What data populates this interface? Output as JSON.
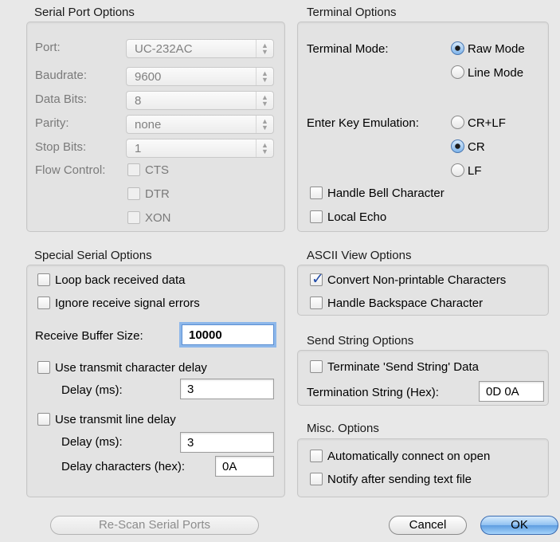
{
  "serial_port_options": {
    "title": "Serial Port Options",
    "port": {
      "label": "Port:",
      "value": "UC-232AC"
    },
    "baudrate": {
      "label": "Baudrate:",
      "value": "9600"
    },
    "data_bits": {
      "label": "Data Bits:",
      "value": "8"
    },
    "parity": {
      "label": "Parity:",
      "value": "none"
    },
    "stop_bits": {
      "label": "Stop Bits:",
      "value": "1"
    },
    "flow_control": {
      "label": "Flow Control:",
      "cts": "CTS",
      "dtr": "DTR",
      "xon": "XON"
    }
  },
  "terminal_options": {
    "title": "Terminal Options",
    "mode_label": "Terminal Mode:",
    "raw_mode": "Raw Mode",
    "line_mode": "Line Mode",
    "selected_mode": "Raw Mode",
    "enter_key_label": "Enter Key Emulation:",
    "crlf": "CR+LF",
    "cr": "CR",
    "lf": "LF",
    "selected_enter": "CR",
    "handle_bell": "Handle Bell Character",
    "local_echo": "Local Echo"
  },
  "special_serial_options": {
    "title": "Special Serial Options",
    "loop_back": "Loop back received data",
    "ignore_errors": "Ignore receive signal errors",
    "buffer_label": "Receive Buffer Size:",
    "buffer_value": "10000",
    "use_char_delay": "Use transmit character delay",
    "char_delay_label": "Delay (ms):",
    "char_delay_value": "3",
    "use_line_delay": "Use transmit line delay",
    "line_delay_label": "Delay (ms):",
    "line_delay_value": "3",
    "delay_chars_label": "Delay characters (hex):",
    "delay_chars_value": "0A"
  },
  "ascii_view_options": {
    "title": "ASCII View Options",
    "convert_nonprintable": "Convert Non-printable Characters",
    "convert_checked": true,
    "handle_backspace": "Handle Backspace Character"
  },
  "send_string_options": {
    "title": "Send String Options",
    "terminate": "Terminate 'Send String' Data",
    "termination_label": "Termination String (Hex):",
    "termination_value": "0D 0A"
  },
  "misc_options": {
    "title": "Misc. Options",
    "auto_connect": "Automatically connect on open",
    "notify_after": "Notify after sending text file"
  },
  "buttons": {
    "rescan": "Re-Scan Serial Ports",
    "cancel": "Cancel",
    "ok": "OK"
  }
}
